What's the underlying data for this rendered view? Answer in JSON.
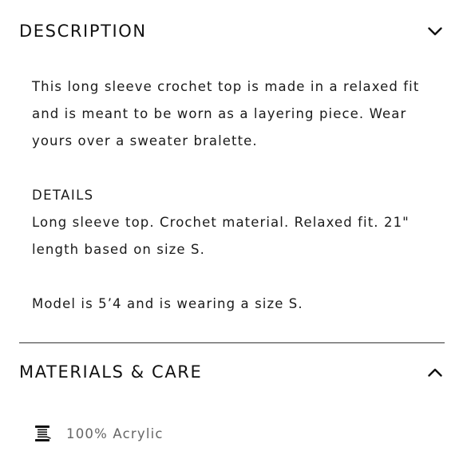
{
  "description": {
    "title": "DESCRIPTION",
    "expanded": true,
    "paragraph": "This long sleeve crochet top is made in a relaxed fit and is meant to be worn as a layering piece. Wear yours over a sweater bralette.",
    "details_heading": "DETAILS",
    "details_text": "Long sleeve top. Crochet material. Relaxed fit. 21\" length based on size S.",
    "model_text": "Model is 5’4 and is wearing a size S."
  },
  "materials": {
    "title": "MATERIALS & CARE",
    "expanded": true,
    "items": [
      {
        "icon": "spool-icon",
        "label": "100% Acrylic"
      }
    ]
  },
  "icons": {
    "description_toggle": "chevron-down-icon",
    "materials_toggle": "chevron-up-icon"
  }
}
